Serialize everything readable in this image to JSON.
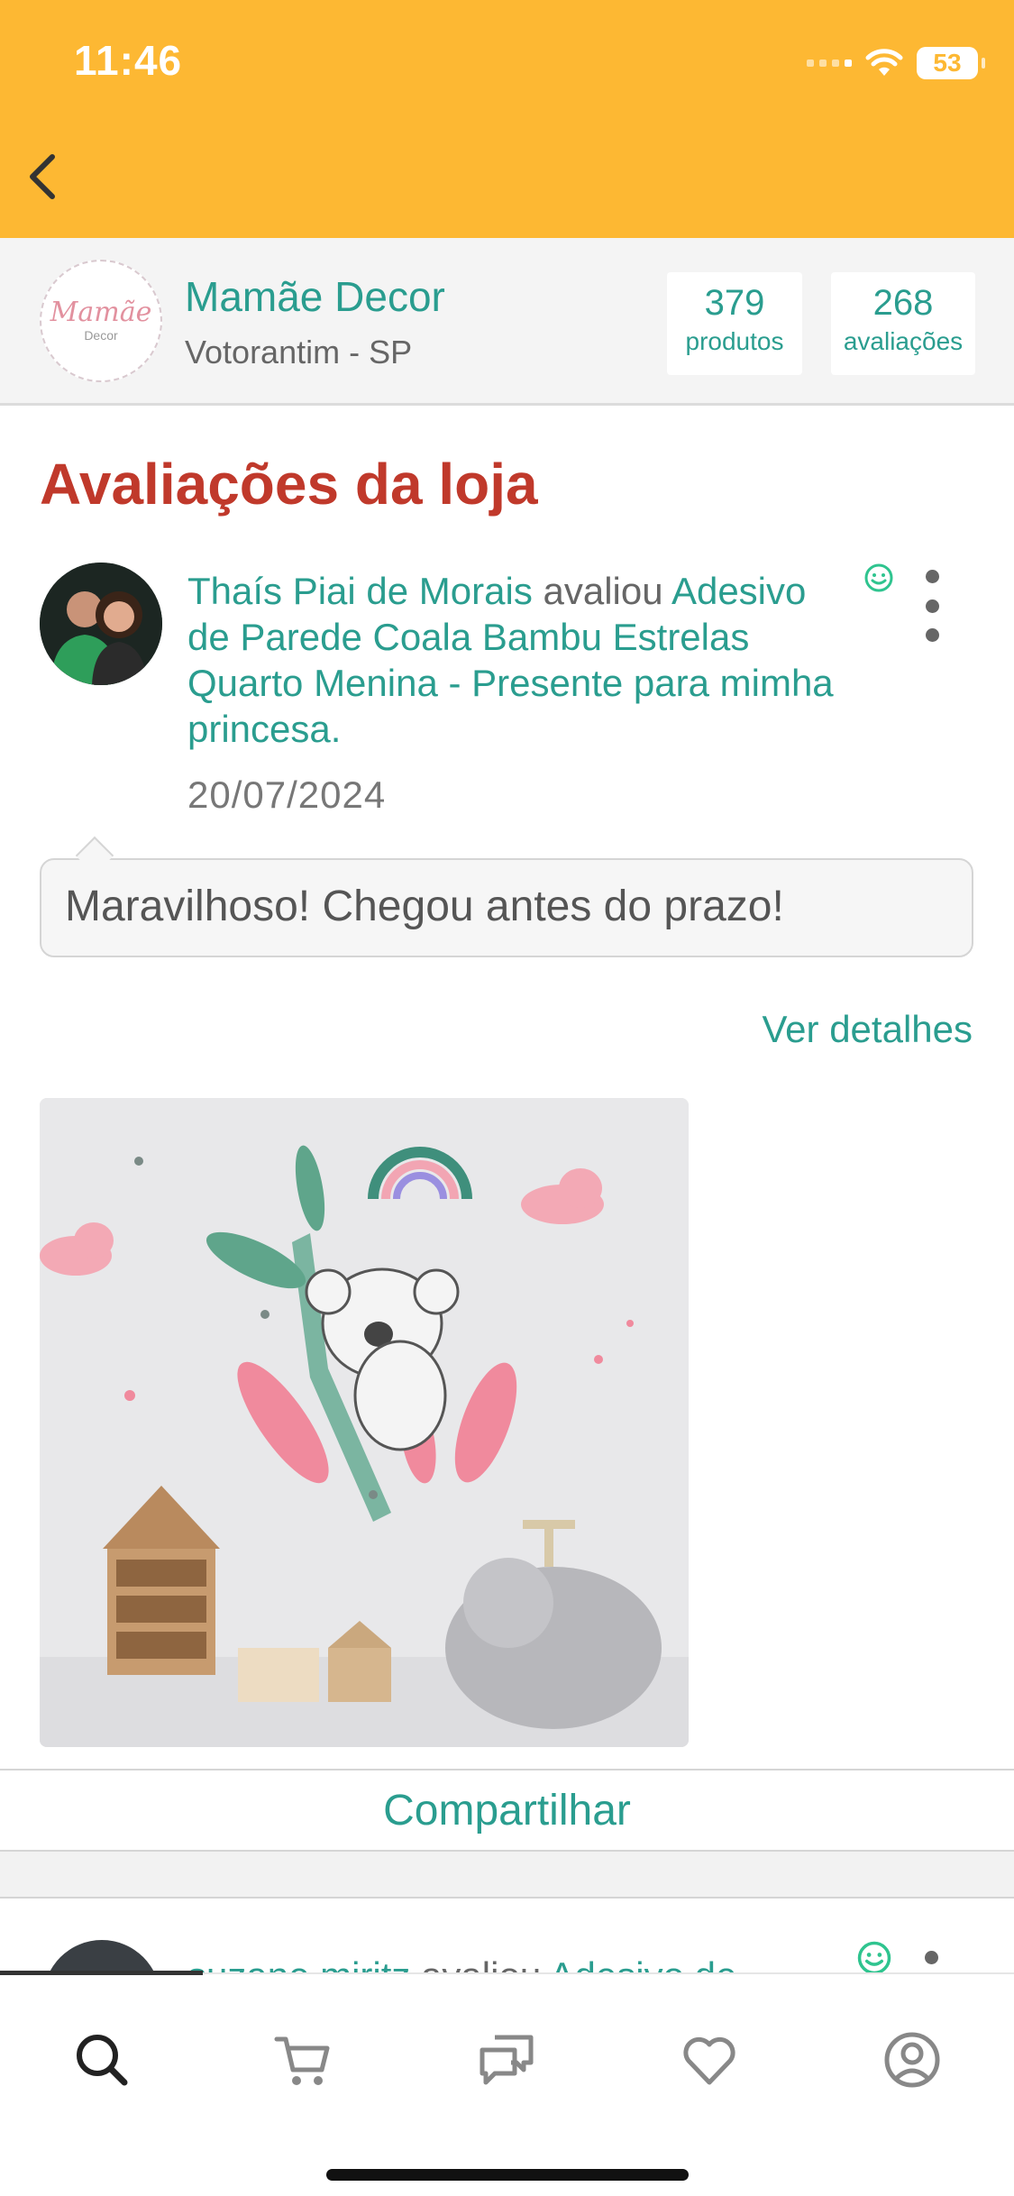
{
  "status_bar": {
    "time": "11:46",
    "battery": "53"
  },
  "header": {
    "back_icon": "chevron-left-icon"
  },
  "store": {
    "logo_text": "Mamãe",
    "logo_subtext": "Decor",
    "name": "Mamãe Decor",
    "location": "Votorantim - SP",
    "products_count": "379",
    "products_label": "produtos",
    "reviews_count": "268",
    "reviews_label": "avaliações"
  },
  "page": {
    "title": "Avaliações da loja"
  },
  "review": {
    "reviewer_name": "Thaís Piai de Morais",
    "action_word": " avaliou ",
    "product_name": "Adesivo de Parede Coala Bambu Estrelas Quarto Menina - Presente para mimha princesa.",
    "date": "20/07/2024",
    "comment": "Maravilhoso! Chegou antes do prazo!",
    "details_link": "Ver detalhes",
    "share_label": "Compartilhar",
    "sentiment_icon": "smiley-icon"
  },
  "next_review": {
    "reviewer_name": "suzane miritz",
    "action_word": " avaliou ",
    "product_name": "Adesivo de"
  },
  "bottom_nav": {
    "items": [
      "search-icon",
      "cart-icon",
      "chat-icon",
      "heart-icon",
      "account-icon"
    ],
    "active": "search-icon"
  },
  "colors": {
    "header_bg": "#FDB833",
    "accent_teal": "#2a9d8f",
    "title_red": "#c0392b"
  }
}
